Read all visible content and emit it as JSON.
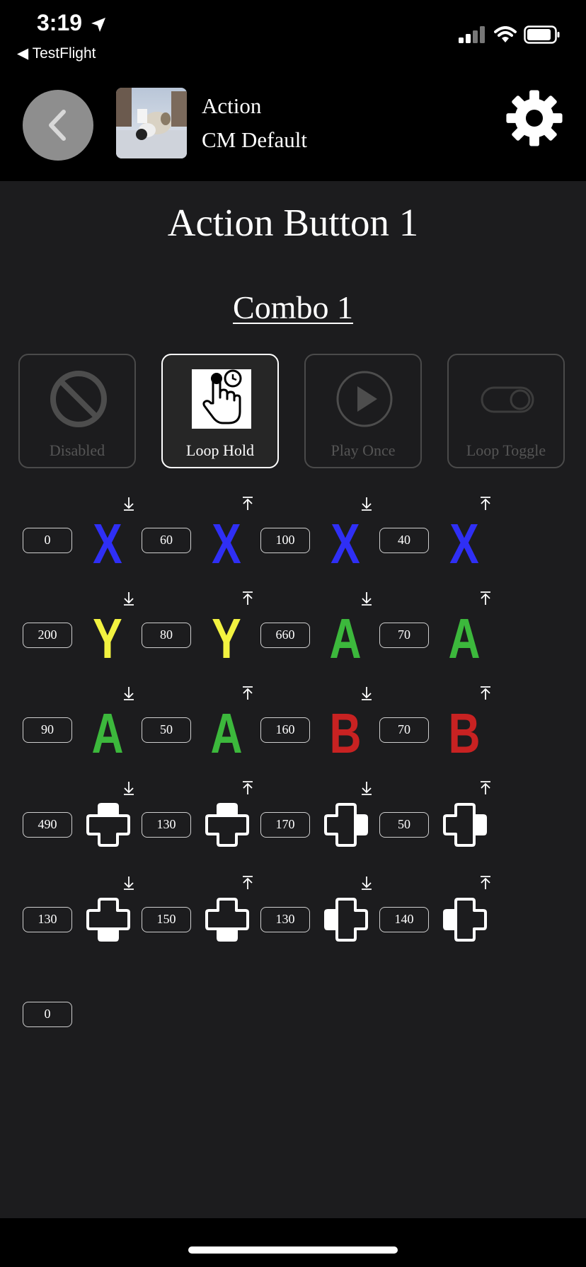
{
  "status": {
    "time": "3:19",
    "back_app": "◀ TestFlight"
  },
  "header": {
    "title": "Action",
    "subtitle": "CM Default"
  },
  "page_title": "Action Button 1",
  "combo_title": "Combo 1",
  "modes": [
    {
      "label": "Disabled",
      "icon": "prohibited-icon",
      "active": false
    },
    {
      "label": "Loop Hold",
      "icon": "hold-hand-icon",
      "active": true
    },
    {
      "label": "Play Once",
      "icon": "play-icon",
      "active": false
    },
    {
      "label": "Loop Toggle",
      "icon": "toggle-icon",
      "active": false
    }
  ],
  "colors": {
    "X": "#2f2ff5",
    "Y": "#f2f240",
    "A": "#3cb83c",
    "B": "#c82222",
    "background": "#1c1c1e"
  },
  "rows": [
    {
      "delays": [
        "0",
        "60",
        "100",
        "40"
      ],
      "buttons": [
        {
          "type": "letter",
          "value": "X",
          "dir": "down"
        },
        {
          "type": "letter",
          "value": "X",
          "dir": "up"
        },
        {
          "type": "letter",
          "value": "X",
          "dir": "down"
        },
        {
          "type": "letter",
          "value": "X",
          "dir": "up"
        }
      ]
    },
    {
      "delays": [
        "200",
        "80",
        "660",
        "70"
      ],
      "buttons": [
        {
          "type": "letter",
          "value": "Y",
          "dir": "down"
        },
        {
          "type": "letter",
          "value": "Y",
          "dir": "up"
        },
        {
          "type": "letter",
          "value": "A",
          "dir": "down"
        },
        {
          "type": "letter",
          "value": "A",
          "dir": "up"
        }
      ]
    },
    {
      "delays": [
        "90",
        "50",
        "160",
        "70"
      ],
      "buttons": [
        {
          "type": "letter",
          "value": "A",
          "dir": "down"
        },
        {
          "type": "letter",
          "value": "A",
          "dir": "up"
        },
        {
          "type": "letter",
          "value": "B",
          "dir": "down"
        },
        {
          "type": "letter",
          "value": "B",
          "dir": "up"
        }
      ]
    },
    {
      "delays": [
        "490",
        "130",
        "170",
        "50"
      ],
      "buttons": [
        {
          "type": "dpad",
          "value": "up",
          "dir": "down"
        },
        {
          "type": "dpad",
          "value": "up",
          "dir": "up"
        },
        {
          "type": "dpad",
          "value": "right",
          "dir": "down"
        },
        {
          "type": "dpad",
          "value": "right",
          "dir": "up"
        }
      ]
    },
    {
      "delays": [
        "130",
        "150",
        "130",
        "140"
      ],
      "buttons": [
        {
          "type": "dpad",
          "value": "down",
          "dir": "down"
        },
        {
          "type": "dpad",
          "value": "down",
          "dir": "up"
        },
        {
          "type": "dpad",
          "value": "left",
          "dir": "down"
        },
        {
          "type": "dpad",
          "value": "left",
          "dir": "up"
        }
      ]
    }
  ],
  "final_delay": "0"
}
